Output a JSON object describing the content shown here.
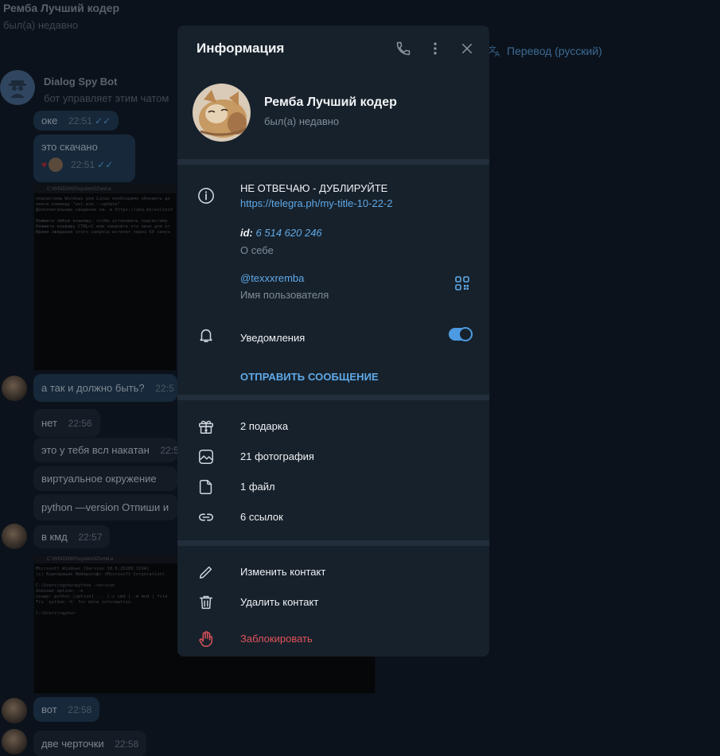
{
  "chat": {
    "title": "Ремба Лучший кодер",
    "status": "был(а) недавно",
    "translate_label": "Перевод (русский)",
    "bot_name": "Dialog Spy Bot",
    "bot_subtitle": "бот управляет этим чатом",
    "messages": [
      {
        "text": "оке",
        "time": "22:51"
      },
      {
        "text": "это скачано",
        "time": "22:51"
      },
      {
        "text": "а так и должно быть?",
        "time": "22:5"
      },
      {
        "text": "нет",
        "time": "22:56"
      },
      {
        "text": "это у тебя всл накатан",
        "time": "22:5"
      },
      {
        "text": "виртуальное окружение",
        "time": ""
      },
      {
        "text": "python —version Отпиши и",
        "time": ""
      },
      {
        "text": "в кмд",
        "time": "22:57"
      },
      {
        "text": "вот",
        "time": "22:58"
      },
      {
        "text": "две черточки",
        "time": "22:58"
      }
    ],
    "screenshot1_title": "C:\\WINDOWS\\system32\\wsl.e",
    "screenshot1_lines": "подсистема Windows для Linux необходимо обновить до\nпните команду \"wsl.exe --update\".\nДополнительные сведения см. в https://aka.ms/wslinst\n\nНажмите любую клавишу, чтобы установить подсистему\nНажмите клавишу CTRL+C или закройте это окно для от\nВремя ожидания этого запроса истечет через 60 секун",
    "screenshot2_title": "C:\\WINDOWS\\system32\\cmd.e",
    "screenshot2_lines": "Microsoft Windows [Version 10.0.26100.3194]\n(c) Корпорация Майкрософт (Microsoft Corporation).\n\nC:\\Users\\ngyhu>python -version\nUnknown option: -e\nusage: python [option] ... [-c cmd | -m mod | file\nTry `python -h' for more information.\n\nC:\\Users\\ngyhu>"
  },
  "panel": {
    "title": "Информация",
    "name": "Ремба Лучший кодер",
    "status": "был(а) недавно",
    "bio": "НЕ ОТВЕЧАЮ - ДУБЛИРУЙТЕ",
    "bio_link": "https://telegra.ph/my-title-10-22-2",
    "id_label": "id:",
    "id_value": "6 514 620 246",
    "about_label": "О себе",
    "username": "@texxxremba",
    "username_label": "Имя пользователя",
    "notifications_label": "Уведомления",
    "notifications_on": true,
    "send_message": "ОТПРАВИТЬ СООБЩЕНИЕ",
    "media": [
      {
        "icon": "gift-icon",
        "label": "2 подарка"
      },
      {
        "icon": "photo-icon",
        "label": "21 фотография"
      },
      {
        "icon": "file-icon",
        "label": "1 файл"
      },
      {
        "icon": "link-icon",
        "label": "6 ссылок"
      }
    ],
    "edit_contact": "Изменить контакт",
    "delete_contact": "Удалить контакт",
    "block": "Заблокировать",
    "colors": {
      "accent": "#5fa9e8",
      "danger": "#e2535a",
      "panel_bg": "#17212b"
    }
  }
}
